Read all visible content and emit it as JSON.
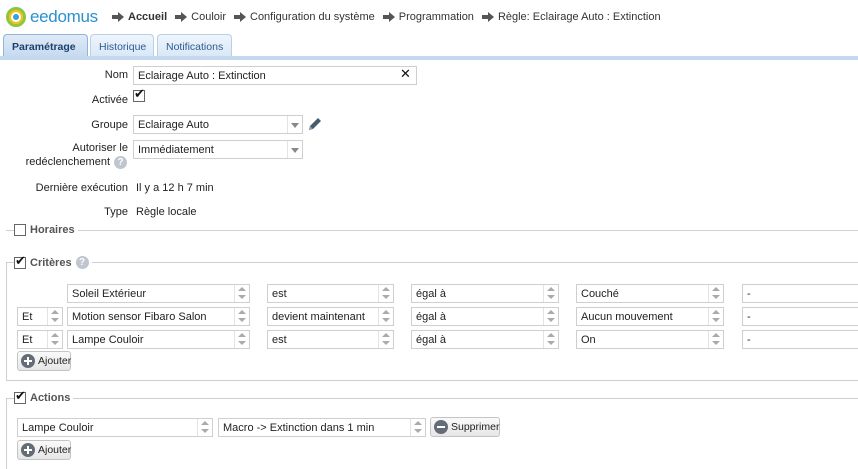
{
  "app": {
    "logo_text": "eedomus"
  },
  "breadcrumb": [
    "Accueil",
    "Couloir",
    "Configuration du système",
    "Programmation",
    "Règle: Eclairage Auto : Extinction"
  ],
  "tabs": [
    "Paramétrage",
    "Historique",
    "Notifications"
  ],
  "form": {
    "nom_label": "Nom",
    "nom_value": "Eclairage Auto : Extinction",
    "activee_label": "Activée",
    "groupe_label": "Groupe",
    "groupe_value": "Eclairage Auto",
    "autoriser_label_1": "Autoriser le",
    "autoriser_label_2": "redéclenchement",
    "autoriser_value": "Immédiatement",
    "derniere_label": "Dernière exécution",
    "derniere_value": "Il y a 12 h 7 min",
    "type_label": "Type",
    "type_value": "Règle locale"
  },
  "horaires": {
    "label": "Horaires",
    "checked": false
  },
  "criteres": {
    "label": "Critères",
    "checked": true,
    "rows": [
      {
        "op": "",
        "device": "Soleil Extérieur",
        "verb": "est",
        "cmp": "égal à",
        "value": "Couché",
        "extra": "-"
      },
      {
        "op": "Et",
        "device": "Motion sensor Fibaro Salon",
        "verb": "devient maintenant",
        "cmp": "égal à",
        "value": "Aucun mouvement",
        "extra": "-"
      },
      {
        "op": "Et",
        "device": "Lampe Couloir",
        "verb": "est",
        "cmp": "égal à",
        "value": "On",
        "extra": "-"
      }
    ],
    "add_label": "Ajouter"
  },
  "actions": {
    "label": "Actions",
    "checked": true,
    "device": "Lampe Couloir",
    "action": "Macro -> Extinction dans 1 min",
    "delete_label": "Supprimer",
    "add_label": "Ajouter"
  },
  "colors": {
    "tab_active_bg": "#c4d9ef",
    "brand": "#2a92cf"
  }
}
